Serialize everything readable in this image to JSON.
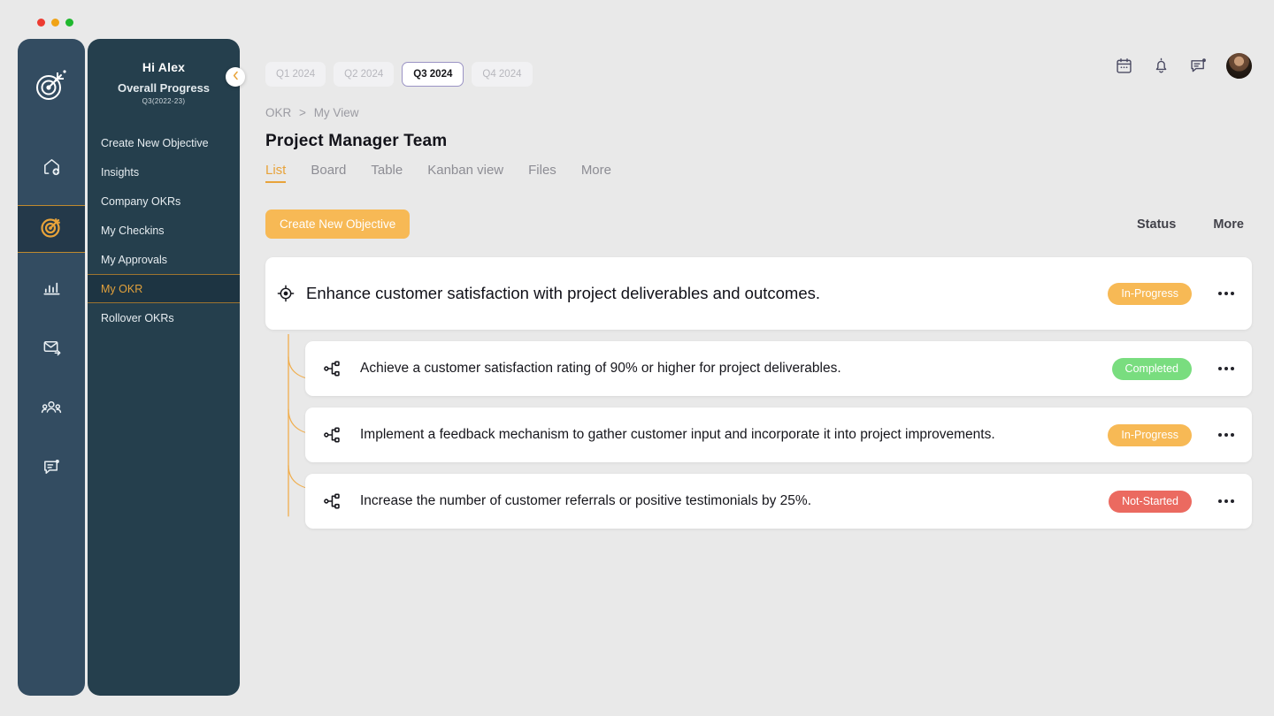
{
  "window": {
    "dots": [
      "red",
      "amber",
      "green"
    ]
  },
  "rail": {
    "logo_icon": "target-logo-icon",
    "items": [
      {
        "icon": "home-add-icon",
        "name": "home",
        "active": false
      },
      {
        "icon": "target-icon",
        "name": "okr",
        "active": true
      },
      {
        "icon": "bar-chart-icon",
        "name": "analytics",
        "active": false
      },
      {
        "icon": "mail-send-icon",
        "name": "messages",
        "active": false
      },
      {
        "icon": "team-icon",
        "name": "team",
        "active": false
      },
      {
        "icon": "feedback-note-icon",
        "name": "feedback",
        "active": false
      }
    ]
  },
  "sidebar": {
    "greeting": "Hi Alex",
    "subtitle": "Overall Progress",
    "period": "Q3(2022-23)",
    "collapse_icon": "chevron-left-icon",
    "items": [
      {
        "label": "Create New Objective",
        "active": false
      },
      {
        "label": "Insights",
        "active": false
      },
      {
        "label": "Company OKRs",
        "active": false
      },
      {
        "label": "My  Checkins",
        "active": false
      },
      {
        "label": "My Approvals",
        "active": false
      },
      {
        "label": "My OKR",
        "active": true
      },
      {
        "label": "Rollover OKRs",
        "active": false
      }
    ]
  },
  "header": {
    "quarter_tabs": [
      {
        "label": "Q1 2024",
        "active": false
      },
      {
        "label": "Q2 2024",
        "active": false
      },
      {
        "label": "Q3 2024",
        "active": true
      },
      {
        "label": "Q4 2024",
        "active": false
      }
    ],
    "icons": [
      {
        "name": "calendar-icon"
      },
      {
        "name": "bell-icon"
      },
      {
        "name": "chat-message-icon",
        "badge": true
      }
    ],
    "avatar": "user-avatar"
  },
  "breadcrumb": {
    "root": "OKR",
    "separator": ">",
    "current": "My View"
  },
  "page": {
    "title": "Project Manager Team",
    "view_tabs": [
      {
        "label": "List",
        "active": true
      },
      {
        "label": "Board",
        "active": false
      },
      {
        "label": "Table",
        "active": false
      },
      {
        "label": "Kanban view",
        "active": false
      },
      {
        "label": "Files",
        "active": false
      },
      {
        "label": "More",
        "active": false
      }
    ]
  },
  "toolbar": {
    "create_label": "Create New Objective",
    "col_status": "Status",
    "col_more": "More"
  },
  "objective": {
    "icon": "objective-target-icon",
    "text": "Enhance customer satisfaction with project deliverables and outcomes.",
    "status": "In-Progress",
    "status_class": "inprogress",
    "key_results": [
      {
        "icon": "key-result-hierarchy-icon",
        "text": "Achieve a customer satisfaction rating of 90% or higher for project deliverables.",
        "status": "Completed",
        "status_class": "completed"
      },
      {
        "icon": "key-result-hierarchy-icon",
        "text": "Implement a feedback mechanism to gather customer input and incorporate it into project improvements.",
        "status": "In-Progress",
        "status_class": "inprogress"
      },
      {
        "icon": "key-result-hierarchy-icon",
        "text": "Increase the number of customer referrals or positive testimonials by 25%.",
        "status": "Not-Started",
        "status_class": "notstarted"
      }
    ]
  },
  "colors": {
    "accent_orange": "#e8a33a",
    "button_orange": "#f7b955",
    "rail_navy": "#334c61",
    "panel_navy": "#253f4d",
    "status_completed": "#79dd7f",
    "status_inprogress": "#f7b955",
    "status_notstarted": "#eb6a60",
    "page_background": "#e9e9e9"
  }
}
